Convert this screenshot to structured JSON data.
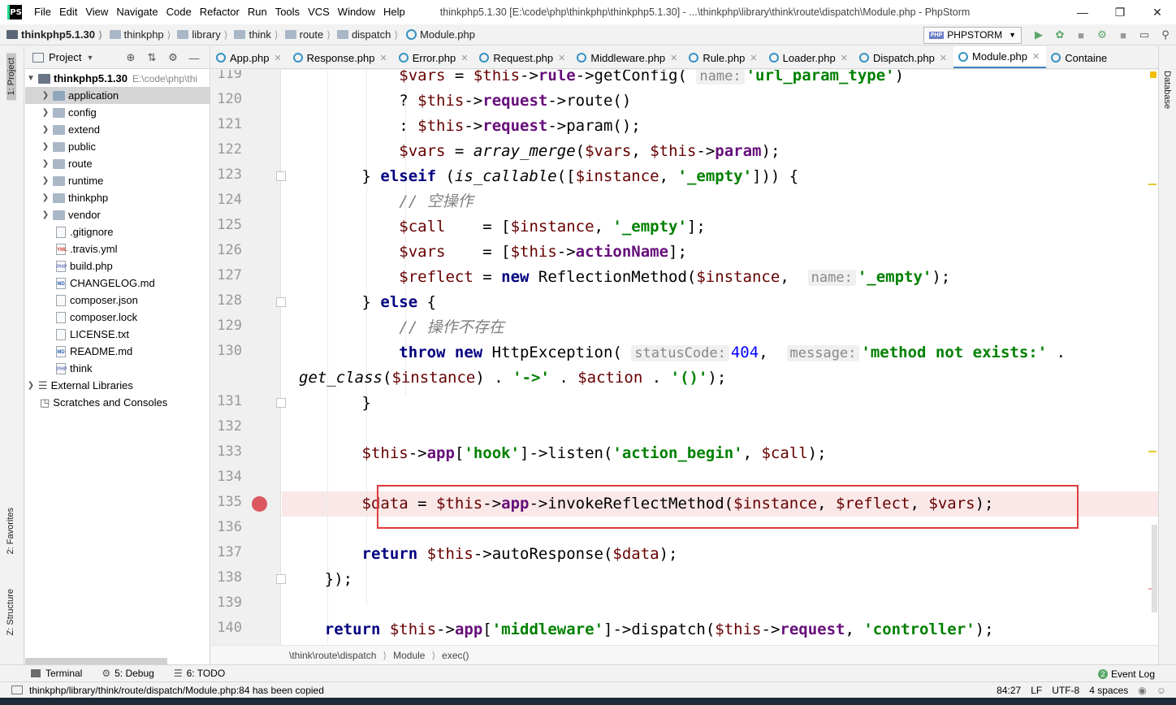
{
  "window": {
    "logo": "PS",
    "menu": [
      "File",
      "Edit",
      "View",
      "Navigate",
      "Code",
      "Refactor",
      "Run",
      "Tools",
      "VCS",
      "Window",
      "Help"
    ],
    "title": "thinkphp5.1.30 [E:\\code\\php\\thinkphp\\thinkphp5.1.30] - ...\\thinkphp\\library\\think\\route\\dispatch\\Module.php - PhpStorm"
  },
  "navbar": {
    "breadcrumbs": [
      "thinkphp5.1.30",
      "thinkphp",
      "library",
      "think",
      "route",
      "dispatch",
      "Module.php"
    ],
    "run_config": "PHPSTORM"
  },
  "tool_windows": {
    "left": [
      "1: Project",
      "2: Favorites",
      "Z: Structure"
    ],
    "right": [
      "Database"
    ]
  },
  "project": {
    "header": "Project",
    "root": {
      "name": "thinkphp5.1.30",
      "path": "E:\\code\\php\\thi"
    },
    "folders": [
      "application",
      "config",
      "extend",
      "public",
      "route",
      "runtime",
      "thinkphp",
      "vendor"
    ],
    "files": [
      {
        "name": ".gitignore",
        "icon": "generic-file-icon"
      },
      {
        "name": ".travis.yml",
        "icon": "yml-file-icon"
      },
      {
        "name": "build.php",
        "icon": "php-file-icon"
      },
      {
        "name": "CHANGELOG.md",
        "icon": "md-file-icon"
      },
      {
        "name": "composer.json",
        "icon": "json-file-icon"
      },
      {
        "name": "composer.lock",
        "icon": "lock-file-icon"
      },
      {
        "name": "LICENSE.txt",
        "icon": "text-file-icon"
      },
      {
        "name": "README.md",
        "icon": "md-file-icon"
      },
      {
        "name": "think",
        "icon": "php-file-icon"
      }
    ],
    "extra": [
      "External Libraries",
      "Scratches and Consoles"
    ],
    "selected": "application"
  },
  "tabs": [
    "App.php",
    "Response.php",
    "Error.php",
    "Request.php",
    "Middleware.php",
    "Rule.php",
    "Loader.php",
    "Dispatch.php",
    "Module.php",
    "Containe"
  ],
  "active_tab": "Module.php",
  "editor": {
    "line_numbers": [
      "119",
      "120",
      "121",
      "122",
      "123",
      "124",
      "125",
      "126",
      "127",
      "128",
      "129",
      "130",
      "",
      "131",
      "132",
      "133",
      "134",
      "135",
      "136",
      "137",
      "138",
      "139",
      "140"
    ],
    "breakpoint_line": "135",
    "highlighted_line": "135"
  },
  "breadcrumb_bar": [
    "\\think\\route\\dispatch",
    "Module",
    "exec()"
  ],
  "bottom_tools": [
    "Terminal",
    "5: Debug",
    "6: TODO"
  ],
  "event_log": "Event Log",
  "status": {
    "message": "thinkphp/library/think/route/dispatch/Module.php:84 has been copied",
    "position": "84:27",
    "line_sep": "LF",
    "encoding": "UTF-8",
    "indent": "4 spaces"
  }
}
